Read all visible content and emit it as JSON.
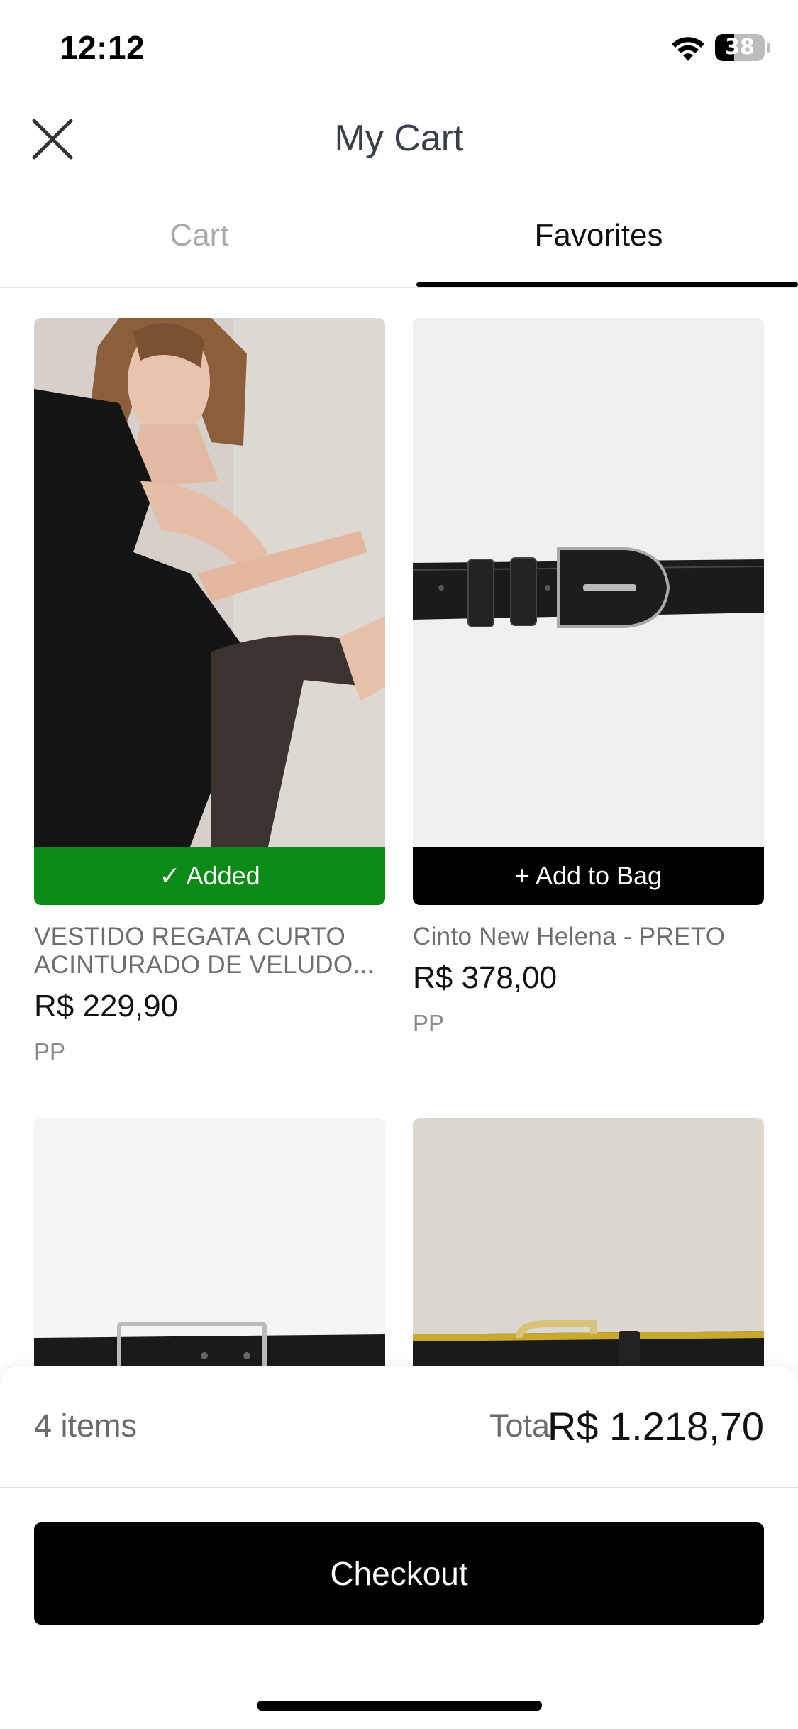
{
  "status_bar": {
    "time": "12:12",
    "battery_level": "38",
    "battery_fraction": 0.38
  },
  "header": {
    "title": "My Cart",
    "close_icon": "close-icon"
  },
  "tabs": [
    {
      "label": "Cart",
      "active": false
    },
    {
      "label": "Favorites",
      "active": true
    }
  ],
  "products": [
    {
      "name_line1": "VESTIDO REGATA CURTO",
      "name_line2": "ACINTURADO DE VELUDO...",
      "price": "R$ 229,90",
      "size": "PP",
      "button_label": "✓ Added",
      "button_color": "#0b8a17"
    },
    {
      "name_line1": "Cinto New Helena - PRETO",
      "price": "R$ 378,00",
      "size": "PP",
      "button_label": "+ Add to Bag",
      "button_color": "#000000"
    },
    {
      "image": "black-belt-silver-buckle"
    },
    {
      "image": "black-belt-gold-buckle"
    }
  ],
  "summary": {
    "items_count": "4 items",
    "total_label": "Total",
    "total_value": "R$ 1.218,70",
    "checkout_label": "Checkout"
  },
  "colors": {
    "added_green": "#0b8a17",
    "primary_black": "#000000",
    "muted_text": "#6e6e6e"
  }
}
